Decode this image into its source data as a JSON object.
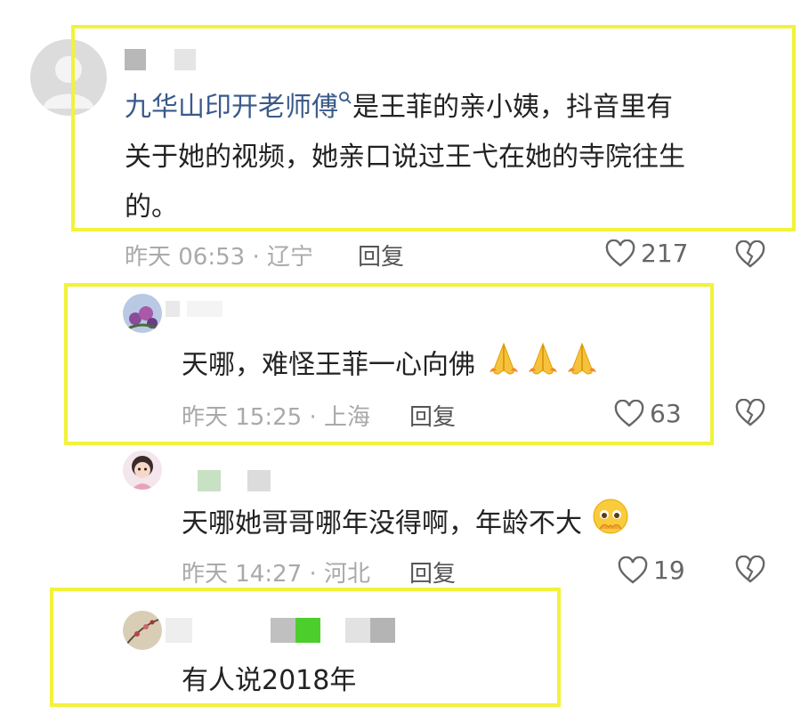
{
  "comments": [
    {
      "mention": "九华山印开老师傅",
      "text_line1": "是王菲的亲小姨，抖音里有",
      "text_line2": "关于她的视频，她亲口说过王弋在她的寺院往生",
      "text_line3": "的。",
      "time": "昨天 06:53 · 辽宁",
      "reply_label": "回复",
      "likes": "217"
    },
    {
      "text": "天哪，难怪王菲一心向佛",
      "time": "昨天 15:25 · 上海",
      "reply_label": "回复",
      "likes": "63"
    },
    {
      "text": "天哪她哥哥哪年没得啊，年龄不大",
      "time": "昨天 14:27 · 河北",
      "reply_label": "回复",
      "likes": "19"
    },
    {
      "text": "有人说2018年"
    }
  ],
  "colors": {
    "highlight": "#f2f23a",
    "mention": "#3a5a8a",
    "meta": "#a9a9a9"
  },
  "icons": [
    "heart-icon",
    "broken-heart-icon",
    "search-icon",
    "pray-emoji",
    "pleading-emoji"
  ]
}
